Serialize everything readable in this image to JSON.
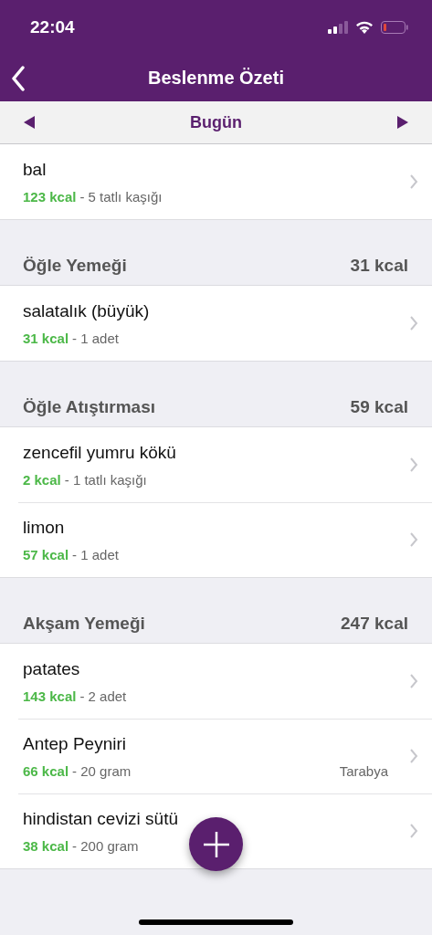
{
  "status_bar": {
    "time": "22:04"
  },
  "nav": {
    "title": "Beslenme Özeti"
  },
  "date_nav": {
    "label": "Bugün"
  },
  "sections": [
    {
      "items": [
        {
          "name": "bal",
          "kcal": "123 kcal",
          "amount": "- 5 tatlı kaşığı"
        }
      ]
    },
    {
      "title": "Öğle Yemeği",
      "total": "31 kcal",
      "items": [
        {
          "name": "salatalık (büyük)",
          "kcal": "31 kcal",
          "amount": "- 1 adet"
        }
      ]
    },
    {
      "title": "Öğle Atıştırması",
      "total": "59 kcal",
      "items": [
        {
          "name": "zencefil yumru kökü",
          "kcal": "2 kcal",
          "amount": "- 1 tatlı kaşığı"
        },
        {
          "name": "limon",
          "kcal": "57 kcal",
          "amount": "- 1 adet"
        }
      ]
    },
    {
      "title": "Akşam Yemeği",
      "total": "247 kcal",
      "items": [
        {
          "name": "patates",
          "kcal": "143 kcal",
          "amount": "- 2 adet"
        },
        {
          "name": "Antep Peyniri",
          "kcal": "66 kcal",
          "amount": "- 20 gram",
          "brand": "Tarabya"
        },
        {
          "name": "hindistan cevizi sütü",
          "kcal": "38 kcal",
          "amount": "- 200 gram"
        }
      ]
    }
  ]
}
